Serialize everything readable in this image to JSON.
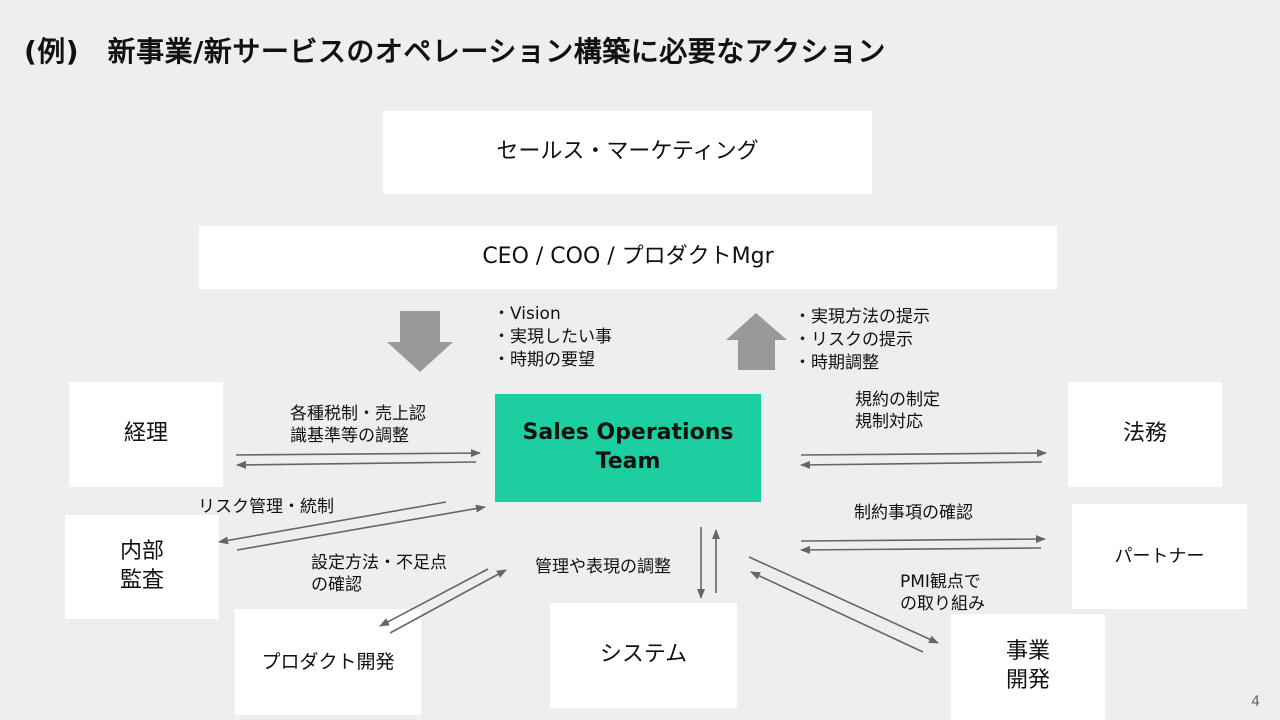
{
  "title": "(例)　新事業/新サービスのオペレーション構築に必要なアクション",
  "boxes": {
    "sales_marketing": "セールス・マーケティング",
    "executives": "CEO / COO / プロダクトMgr",
    "core_team": "Sales Operations\nTeam",
    "accounting": "経理",
    "internal_audit": "内部\n監査",
    "product_dev": "プロダクト開発",
    "system": "システム",
    "legal": "法務",
    "partner": "パートナー",
    "biz_dev": "事業\n開発"
  },
  "down_flow": {
    "icon": "arrow-down",
    "items": [
      "・Vision",
      "・実現したい事",
      "・時期の要望"
    ]
  },
  "up_flow": {
    "icon": "arrow-up",
    "items": [
      "・実現方法の提示",
      "・リスクの提示",
      "・時期調整"
    ]
  },
  "edge_labels": {
    "accounting": "各種税制・売上認\n識基準等の調整",
    "internal_audit": "リスク管理・統制",
    "product_dev": "設定方法・不足点\nの確認",
    "system": "管理や表現の調整",
    "legal": "規約の制定\n規制対応",
    "partner": "制約事項の確認",
    "biz_dev": "PMI観点で\nの取り組み"
  },
  "page_number": "4",
  "colors": {
    "background": "#eeeeee",
    "core_team": "#1ccfa0",
    "arrow": "#666666",
    "block_arrow": "#999999"
  }
}
